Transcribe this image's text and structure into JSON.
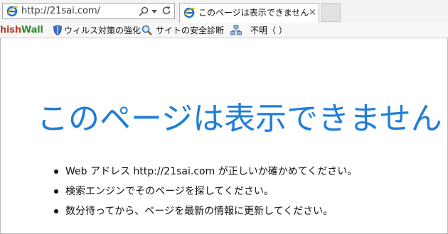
{
  "browser": {
    "address": "http://21sai.com/",
    "tab_title": "このページは表示できません",
    "tab_close": "×"
  },
  "favorites": {
    "phishwall_part1": "hish",
    "phishwall_part2": "Wall",
    "virus_label": "ウィルス対策の強化",
    "site_label": "サイトの安全診断",
    "unknown_label": "不明（ ）"
  },
  "content": {
    "title": "このページは表示できません",
    "items": [
      "Web アドレス http://21sai.com が正しいか確かめてください。",
      "検索エンジンでそのページを探してください。",
      "数分待ってから、ページを最新の情報に更新してください。"
    ]
  },
  "colors": {
    "title": "#1f7ed8",
    "phish_red": "#c0392b",
    "phish_green": "#2e8b2e"
  },
  "icons": [
    "ie-icon",
    "search-icon",
    "dropdown-icon",
    "refresh-icon",
    "close-icon",
    "shield-icon",
    "magnifier-icon",
    "network-icon"
  ]
}
